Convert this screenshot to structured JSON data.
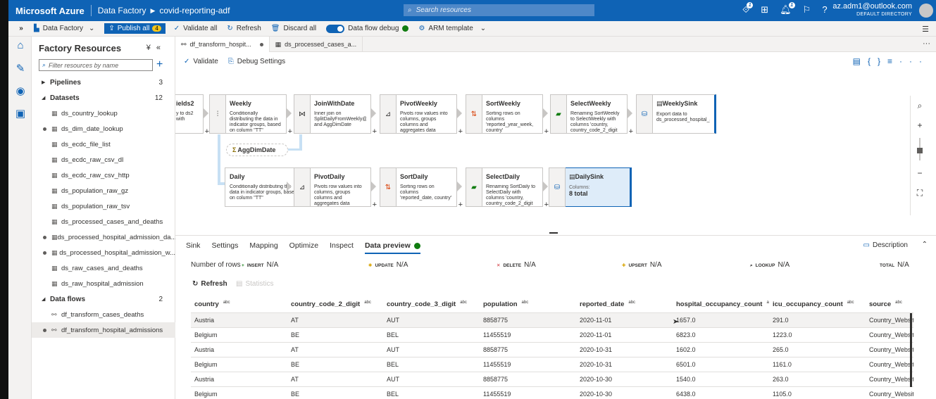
{
  "topbar": {
    "brand": "Microsoft Azure",
    "service": "Data Factory",
    "factory": "covid-reporting-adf",
    "search_placeholder": "Search resources",
    "notif_count_1": "1",
    "notif_count_2": "1",
    "email": "az.adm1@outlook.com",
    "directory": "DEFAULT DIRECTORY"
  },
  "toolbar": {
    "data_factory": "Data Factory",
    "publish_all": "Publish all",
    "publish_count": "4",
    "validate_all": "Validate all",
    "refresh": "Refresh",
    "discard_all": "Discard all",
    "data_flow_debug": "Data flow debug",
    "arm_template": "ARM template"
  },
  "panel": {
    "title": "Factory Resources",
    "filter_placeholder": "Filter resources by name",
    "pipelines": {
      "label": "Pipelines",
      "count": "3"
    },
    "datasets": {
      "label": "Datasets",
      "count": "12"
    },
    "dataset_items": [
      {
        "label": "ds_country_lookup",
        "dot": false
      },
      {
        "label": "ds_dim_date_lookup",
        "dot": true
      },
      {
        "label": "ds_ecdc_file_list",
        "dot": false
      },
      {
        "label": "ds_ecdc_raw_csv_dl",
        "dot": false
      },
      {
        "label": "ds_ecdc_raw_csv_http",
        "dot": false
      },
      {
        "label": "ds_population_raw_gz",
        "dot": false
      },
      {
        "label": "ds_population_raw_tsv",
        "dot": false
      },
      {
        "label": "ds_processed_cases_and_deaths",
        "dot": false
      },
      {
        "label": "ds_processed_hospital_admission_da...",
        "dot": true
      },
      {
        "label": "ds_processed_hospital_admission_w...",
        "dot": true
      },
      {
        "label": "ds_raw_cases_and_deaths",
        "dot": false
      },
      {
        "label": "ds_raw_hospital_admission",
        "dot": false
      }
    ],
    "dataflows": {
      "label": "Data flows",
      "count": "2"
    },
    "dataflow_items": [
      {
        "label": "df_transform_cases_deaths",
        "dot": false
      },
      {
        "label": "df_transform_hospital_admissions",
        "dot": true
      }
    ]
  },
  "tabs": [
    {
      "label": "df_transform_hospit..."
    },
    {
      "label": "ds_processed_cases_a..."
    }
  ],
  "canvas_toolbar": {
    "validate": "Validate",
    "debug_settings": "Debug Settings"
  },
  "nodes": {
    "split_partial": {
      "title": "ields2",
      "desc": "y to\nds2 with"
    },
    "weekly": {
      "title": "Weekly",
      "desc": "Conditionally distributing the data in indicator groups, based on column \"TT\""
    },
    "join": {
      "title": "JoinWithDate",
      "desc": "Inner join on SplitDailyFromWeekly@Weekly and AggDimDate"
    },
    "pivot_weekly": {
      "title": "PivotWeekly",
      "desc": "Pivots row values into columns, groups columns and aggregates data"
    },
    "sort_weekly": {
      "title": "SortWeekly",
      "desc": "Sorting rows on columns 'reported_year_week, country'"
    },
    "select_weekly": {
      "title": "SelectWeekly",
      "desc": "Renaming SortWeekly to SelectWeekly with columns 'country, country_code_2_digit"
    },
    "weekly_sink": {
      "title": "WeeklySink",
      "desc": "Export data to ds_processed_hospital_admission_weekly"
    },
    "agg": {
      "title": "AggDimDate"
    },
    "daily": {
      "title": "Daily",
      "desc": "Conditionally distributing the data in indicator groups, based on column \"TT\""
    },
    "pivot_daily": {
      "title": "PivotDaily",
      "desc": "Pivots row values into columns, groups columns and aggregates data"
    },
    "sort_daily": {
      "title": "SortDaily",
      "desc": "Sorting rows on columns 'reported_date, country'"
    },
    "select_daily": {
      "title": "SelectDaily",
      "desc": "Renaming SortDaily to SelectDaily with columns 'country, country_code_2_digit"
    },
    "daily_sink": {
      "title": "DailySink",
      "columns_label": "Columns:",
      "columns_total": "8 total"
    }
  },
  "bottom": {
    "tabs": [
      "Sink",
      "Settings",
      "Mapping",
      "Optimize",
      "Inspect",
      "Data preview"
    ],
    "description": "Description",
    "number_of_rows": "Number of rows",
    "counts": {
      "insert": {
        "k": "INSERT",
        "v": "N/A"
      },
      "update": {
        "k": "UPDATE",
        "v": "N/A"
      },
      "delete": {
        "k": "DELETE",
        "v": "N/A"
      },
      "upsert": {
        "k": "UPSERT",
        "v": "N/A"
      },
      "lookup": {
        "k": "LOOKUP",
        "v": "N/A"
      },
      "total": {
        "k": "TOTAL",
        "v": "N/A"
      }
    },
    "refresh": "Refresh",
    "statistics": "Statistics"
  },
  "table": {
    "type_tag": "abc",
    "columns": [
      "country",
      "country_code_2_digit",
      "country_code_3_digit",
      "population",
      "reported_date",
      "hospital_occupancy_count",
      "icu_occupancy_count",
      "source"
    ],
    "rows": [
      [
        "Austria",
        "AT",
        "AUT",
        "8858775",
        "2020-11-01",
        "1657.0",
        "291.0",
        "Country_Websit"
      ],
      [
        "Belgium",
        "BE",
        "BEL",
        "11455519",
        "2020-11-01",
        "6823.0",
        "1223.0",
        "Country_Websit"
      ],
      [
        "Austria",
        "AT",
        "AUT",
        "8858775",
        "2020-10-31",
        "1602.0",
        "265.0",
        "Country_Websit"
      ],
      [
        "Belgium",
        "BE",
        "BEL",
        "11455519",
        "2020-10-31",
        "6501.0",
        "1161.0",
        "Country_Websit"
      ],
      [
        "Austria",
        "AT",
        "AUT",
        "8858775",
        "2020-10-30",
        "1540.0",
        "263.0",
        "Country_Websit"
      ],
      [
        "Belgium",
        "BE",
        "BEL",
        "11455519",
        "2020-10-30",
        "6438.0",
        "1105.0",
        "Country_Websit"
      ]
    ]
  }
}
